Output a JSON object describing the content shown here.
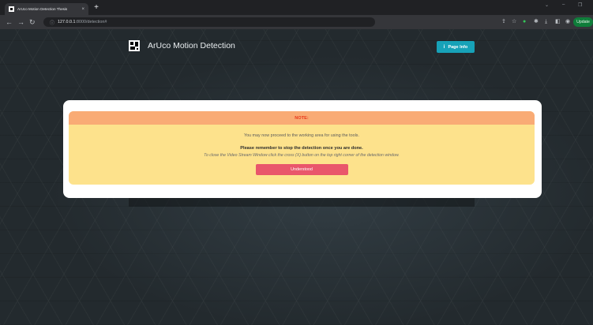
{
  "browser": {
    "tab_title": "ArUco Motion Detection Thesis",
    "tab_close": "×",
    "new_tab": "+",
    "url_host": "127.0.0.1",
    "url_path": ":8000/detection#",
    "update_label": "Update",
    "window_controls": [
      "⌄",
      "–",
      "❐"
    ]
  },
  "navbar": {
    "brand": "ArUco Motion Detection",
    "page_info_label": "Page Info",
    "info_icon": "i"
  },
  "modal": {
    "heading": "NOTE:",
    "line1": "You may now proceed to the working area for using the tools.",
    "line2": "Please remember to stop the detection once you are done.",
    "line3": "To close the Video Stream Window click the cross (X) button on the top right corner of the detection window.",
    "button_label": "Understood",
    "colors": {
      "header_bg": "#f9ab75",
      "header_text": "#e8381c",
      "body_bg": "#fde28c",
      "button_bg": "#e9566b"
    }
  },
  "icons": {
    "back": "back-arrow-icon",
    "forward": "forward-arrow-icon",
    "reload": "reload-icon",
    "site_info": "info-circle-icon",
    "share": "share-icon",
    "bookmark": "star-icon",
    "extension": "extension-icon",
    "puzzle": "puzzle-icon",
    "download": "download-icon",
    "sidepanel": "sidepanel-icon",
    "profile": "profile-icon"
  },
  "accent_color": "#17a2b8"
}
